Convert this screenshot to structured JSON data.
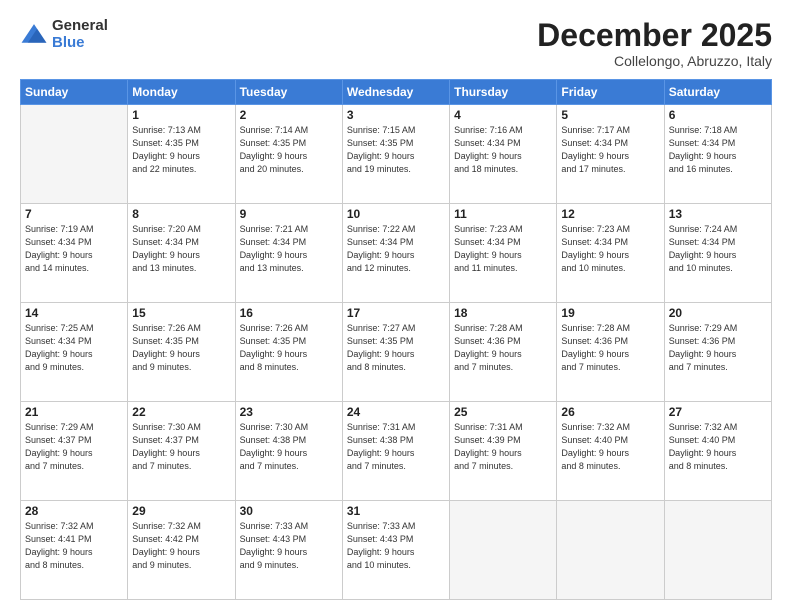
{
  "logo": {
    "general": "General",
    "blue": "Blue"
  },
  "header": {
    "month": "December 2025",
    "location": "Collelongo, Abruzzo, Italy"
  },
  "weekdays": [
    "Sunday",
    "Monday",
    "Tuesday",
    "Wednesday",
    "Thursday",
    "Friday",
    "Saturday"
  ],
  "weeks": [
    [
      {
        "day": "",
        "info": ""
      },
      {
        "day": "1",
        "info": "Sunrise: 7:13 AM\nSunset: 4:35 PM\nDaylight: 9 hours\nand 22 minutes."
      },
      {
        "day": "2",
        "info": "Sunrise: 7:14 AM\nSunset: 4:35 PM\nDaylight: 9 hours\nand 20 minutes."
      },
      {
        "day": "3",
        "info": "Sunrise: 7:15 AM\nSunset: 4:35 PM\nDaylight: 9 hours\nand 19 minutes."
      },
      {
        "day": "4",
        "info": "Sunrise: 7:16 AM\nSunset: 4:34 PM\nDaylight: 9 hours\nand 18 minutes."
      },
      {
        "day": "5",
        "info": "Sunrise: 7:17 AM\nSunset: 4:34 PM\nDaylight: 9 hours\nand 17 minutes."
      },
      {
        "day": "6",
        "info": "Sunrise: 7:18 AM\nSunset: 4:34 PM\nDaylight: 9 hours\nand 16 minutes."
      }
    ],
    [
      {
        "day": "7",
        "info": "Sunrise: 7:19 AM\nSunset: 4:34 PM\nDaylight: 9 hours\nand 14 minutes."
      },
      {
        "day": "8",
        "info": "Sunrise: 7:20 AM\nSunset: 4:34 PM\nDaylight: 9 hours\nand 13 minutes."
      },
      {
        "day": "9",
        "info": "Sunrise: 7:21 AM\nSunset: 4:34 PM\nDaylight: 9 hours\nand 13 minutes."
      },
      {
        "day": "10",
        "info": "Sunrise: 7:22 AM\nSunset: 4:34 PM\nDaylight: 9 hours\nand 12 minutes."
      },
      {
        "day": "11",
        "info": "Sunrise: 7:23 AM\nSunset: 4:34 PM\nDaylight: 9 hours\nand 11 minutes."
      },
      {
        "day": "12",
        "info": "Sunrise: 7:23 AM\nSunset: 4:34 PM\nDaylight: 9 hours\nand 10 minutes."
      },
      {
        "day": "13",
        "info": "Sunrise: 7:24 AM\nSunset: 4:34 PM\nDaylight: 9 hours\nand 10 minutes."
      }
    ],
    [
      {
        "day": "14",
        "info": "Sunrise: 7:25 AM\nSunset: 4:34 PM\nDaylight: 9 hours\nand 9 minutes."
      },
      {
        "day": "15",
        "info": "Sunrise: 7:26 AM\nSunset: 4:35 PM\nDaylight: 9 hours\nand 9 minutes."
      },
      {
        "day": "16",
        "info": "Sunrise: 7:26 AM\nSunset: 4:35 PM\nDaylight: 9 hours\nand 8 minutes."
      },
      {
        "day": "17",
        "info": "Sunrise: 7:27 AM\nSunset: 4:35 PM\nDaylight: 9 hours\nand 8 minutes."
      },
      {
        "day": "18",
        "info": "Sunrise: 7:28 AM\nSunset: 4:36 PM\nDaylight: 9 hours\nand 7 minutes."
      },
      {
        "day": "19",
        "info": "Sunrise: 7:28 AM\nSunset: 4:36 PM\nDaylight: 9 hours\nand 7 minutes."
      },
      {
        "day": "20",
        "info": "Sunrise: 7:29 AM\nSunset: 4:36 PM\nDaylight: 9 hours\nand 7 minutes."
      }
    ],
    [
      {
        "day": "21",
        "info": "Sunrise: 7:29 AM\nSunset: 4:37 PM\nDaylight: 9 hours\nand 7 minutes."
      },
      {
        "day": "22",
        "info": "Sunrise: 7:30 AM\nSunset: 4:37 PM\nDaylight: 9 hours\nand 7 minutes."
      },
      {
        "day": "23",
        "info": "Sunrise: 7:30 AM\nSunset: 4:38 PM\nDaylight: 9 hours\nand 7 minutes."
      },
      {
        "day": "24",
        "info": "Sunrise: 7:31 AM\nSunset: 4:38 PM\nDaylight: 9 hours\nand 7 minutes."
      },
      {
        "day": "25",
        "info": "Sunrise: 7:31 AM\nSunset: 4:39 PM\nDaylight: 9 hours\nand 7 minutes."
      },
      {
        "day": "26",
        "info": "Sunrise: 7:32 AM\nSunset: 4:40 PM\nDaylight: 9 hours\nand 8 minutes."
      },
      {
        "day": "27",
        "info": "Sunrise: 7:32 AM\nSunset: 4:40 PM\nDaylight: 9 hours\nand 8 minutes."
      }
    ],
    [
      {
        "day": "28",
        "info": "Sunrise: 7:32 AM\nSunset: 4:41 PM\nDaylight: 9 hours\nand 8 minutes."
      },
      {
        "day": "29",
        "info": "Sunrise: 7:32 AM\nSunset: 4:42 PM\nDaylight: 9 hours\nand 9 minutes."
      },
      {
        "day": "30",
        "info": "Sunrise: 7:33 AM\nSunset: 4:43 PM\nDaylight: 9 hours\nand 9 minutes."
      },
      {
        "day": "31",
        "info": "Sunrise: 7:33 AM\nSunset: 4:43 PM\nDaylight: 9 hours\nand 10 minutes."
      },
      {
        "day": "",
        "info": ""
      },
      {
        "day": "",
        "info": ""
      },
      {
        "day": "",
        "info": ""
      }
    ]
  ]
}
